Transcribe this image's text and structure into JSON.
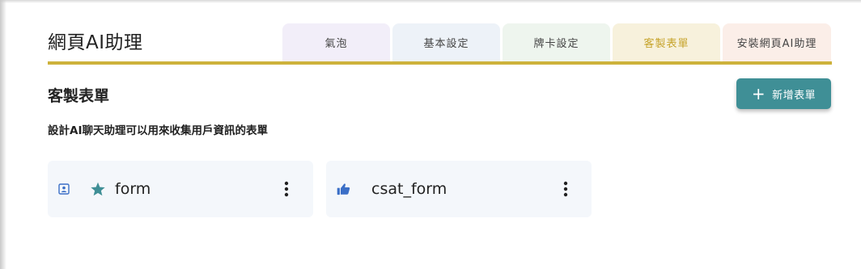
{
  "app_title": "網頁AI助理",
  "tabs": [
    {
      "label": "氣泡"
    },
    {
      "label": "基本設定"
    },
    {
      "label": "牌卡設定"
    },
    {
      "label": "客製表單"
    },
    {
      "label": "安裝網頁AI助理"
    }
  ],
  "active_tab": "客製表單",
  "section": {
    "title": "客製表單",
    "description": "設計AI聊天助理可以用來收集用戶資訊的表單",
    "add_button_label": "新增表單"
  },
  "forms": [
    {
      "name": "form",
      "type_icon": "contact-card-icon",
      "badge_icon": "star-icon"
    },
    {
      "name": "csat_form",
      "type_icon": "thumbs-up-icon"
    }
  ],
  "colors": {
    "accent_gold": "#cdb23b",
    "active_tab_text": "#c6a32a",
    "button_teal": "#3f8f96",
    "star_teal": "#3f8f96",
    "icon_blue": "#3b6fc7"
  }
}
